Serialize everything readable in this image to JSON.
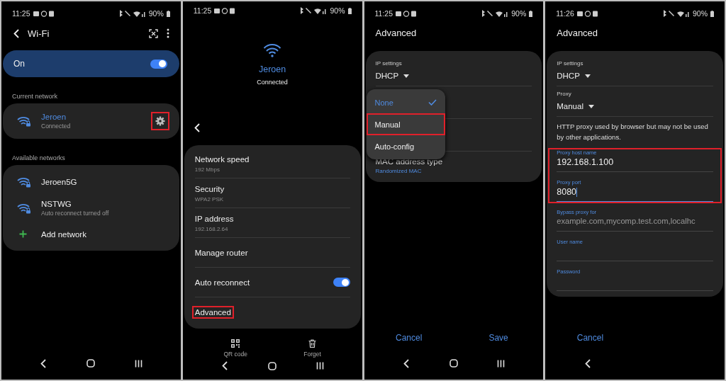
{
  "screens": [
    {
      "kind": "wifi_list",
      "status_bar": {
        "time": "11:25",
        "battery": "90%"
      },
      "header": {
        "title": "Wi-Fi"
      },
      "master_switch": {
        "label": "On",
        "on": true
      },
      "current_network": {
        "heading": "Current network",
        "name": "Jeroen",
        "status": "Connected",
        "settings_highlighted": true
      },
      "available_networks": {
        "heading": "Available networks",
        "items": [
          {
            "kind": "network",
            "name": "Jeroen5G"
          },
          {
            "kind": "network",
            "name": "NSTWG",
            "subtitle": "Auto reconnect turned off"
          },
          {
            "kind": "add",
            "name": "Add network"
          }
        ]
      },
      "nav": [
        {
          "kind": "back"
        },
        {
          "kind": "home"
        },
        {
          "kind": "recents"
        }
      ]
    },
    {
      "kind": "network_detail",
      "status_bar": {
        "time": "11:25",
        "battery": "90%"
      },
      "network": {
        "name": "Jeroen",
        "status": "Connected"
      },
      "rows": [
        {
          "kind": "info",
          "title": "Network speed",
          "subtitle": "192 Mbps",
          "highlighted": false
        },
        {
          "kind": "info",
          "title": "Security",
          "subtitle": "WPA2 PSK",
          "highlighted": false
        },
        {
          "kind": "info",
          "title": "IP address",
          "subtitle": "192.168.2.64",
          "highlighted": false
        },
        {
          "kind": "plain",
          "title": "Manage router",
          "highlighted": false
        },
        {
          "kind": "toggle",
          "title": "Auto reconnect",
          "on": true,
          "highlighted": false
        },
        {
          "kind": "plain",
          "title": "Advanced",
          "highlighted": true
        }
      ],
      "actions": [
        {
          "kind": "qr",
          "label": "QR code"
        },
        {
          "kind": "delete",
          "label": "Forget"
        }
      ],
      "nav": [
        {
          "kind": "back"
        },
        {
          "kind": "home"
        },
        {
          "kind": "recents"
        }
      ]
    },
    {
      "kind": "advanced",
      "status_bar": {
        "time": "11:25",
        "battery": "90%"
      },
      "title": "Advanced",
      "fields": [
        {
          "kind": "dropdown",
          "label": "IP settings",
          "value": "DHCP"
        },
        {
          "kind": "covered"
        },
        {
          "kind": "info",
          "title": "MAC address type",
          "subtitle": "Randomized MAC"
        }
      ],
      "popup_menu": [
        {
          "label": "None",
          "selected": true,
          "highlighted": false
        },
        {
          "label": "Manual",
          "selected": false,
          "highlighted": true
        },
        {
          "label": "Auto-config",
          "selected": false,
          "highlighted": false
        }
      ],
      "actions": [
        {
          "kind": "text",
          "label": "Cancel"
        },
        {
          "kind": "text",
          "label": "Save"
        }
      ],
      "nav": [
        {
          "kind": "back"
        },
        {
          "kind": "home"
        },
        {
          "kind": "recents"
        }
      ]
    },
    {
      "kind": "advanced",
      "status_bar": {
        "time": "11:26",
        "battery": "90%"
      },
      "title": "Advanced",
      "fields": [
        {
          "kind": "dropdown",
          "label": "IP settings",
          "value": "DHCP"
        },
        {
          "kind": "dropdown",
          "label": "Proxy",
          "value": "Manual"
        },
        {
          "kind": "note",
          "text": "HTTP proxy used by browser but may not be used by other applications."
        },
        {
          "kind": "group",
          "highlighted": true,
          "fields": [
            {
              "kind": "text_field",
              "label": "Proxy host name",
              "value": "192.168.1.100",
              "focused": false
            },
            {
              "kind": "text_field",
              "label": "Proxy port",
              "value": "8080",
              "focused": true
            }
          ]
        },
        {
          "kind": "text_field",
          "label": "Bypass proxy for",
          "placeholder": "example.com,mycomp.test.com,localhc",
          "focused": false
        },
        {
          "kind": "text_field",
          "label": "User name",
          "focused": false
        },
        {
          "kind": "text_field",
          "label": "Password",
          "focused": false
        }
      ],
      "actions": [
        {
          "kind": "text",
          "label": "Cancel"
        }
      ],
      "nav": [
        {
          "kind": "back"
        }
      ]
    }
  ]
}
